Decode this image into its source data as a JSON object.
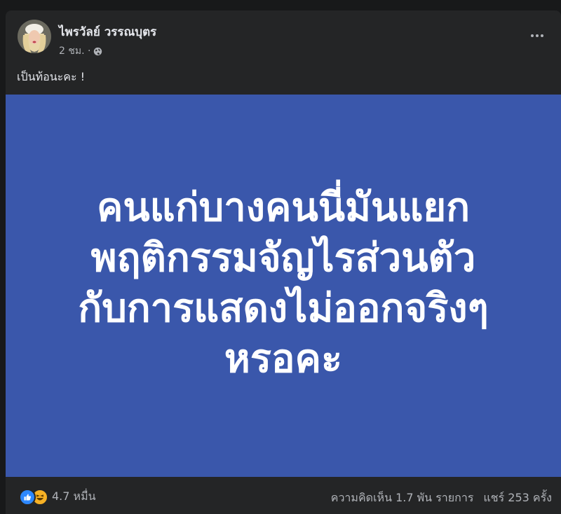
{
  "post": {
    "author": "ไพรวัลย์ วรรณบุตร",
    "time": "2 ชม. ·",
    "text": "เป็นท้อนะคะ !",
    "image_text": "คนแก่บางคนนี่มันแยก\nพฤติกรรมจัญไรส่วนตัว\nกับการแสดงไม่ออกจริงๆ\nหรอคะ"
  },
  "footer": {
    "reaction_count": "4.7 หมื่น",
    "comments": "ความคิดเห็น 1.7 พัน รายการ",
    "shares": "แชร์ 253 ครั้ง"
  },
  "icons": {
    "audience": "globe-icon",
    "menu": "more-options-icon",
    "reactions": [
      "like-icon",
      "haha-icon"
    ]
  },
  "colors": {
    "background": "#18191a",
    "card": "#242526",
    "image_background": "#3a57ab",
    "like": "#2d88ff",
    "haha": "#f7b125",
    "secondary_text": "#b0b3b8"
  }
}
